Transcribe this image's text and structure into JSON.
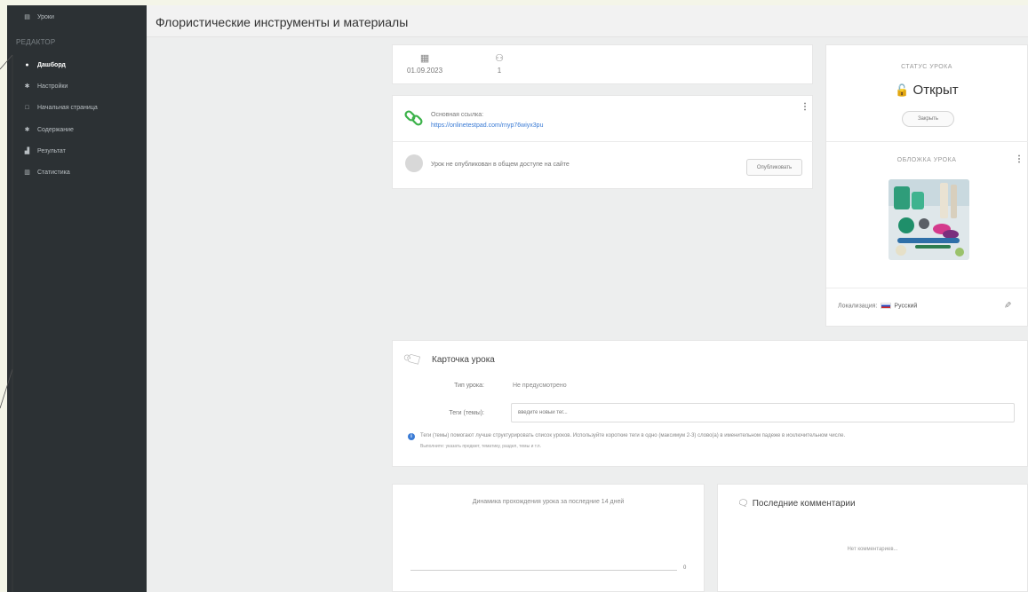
{
  "sidebar": {
    "top_item": {
      "label": "Уроки",
      "icon": "lessons-icon"
    },
    "section": "РЕДАКТОР",
    "items": [
      {
        "label": "Дашборд",
        "icon": "dashboard-icon",
        "active": true
      },
      {
        "label": "Настройки",
        "icon": "gear-icon",
        "active": false
      },
      {
        "label": "Начальная страница",
        "icon": "page-icon",
        "active": false
      },
      {
        "label": "Содержание",
        "icon": "gear-icon",
        "active": false
      },
      {
        "label": "Результат",
        "icon": "results-icon",
        "active": false
      },
      {
        "label": "Статистика",
        "icon": "stats-icon",
        "active": false
      }
    ]
  },
  "header": {
    "title": "Флористические инструменты и материалы"
  },
  "stats": {
    "date": "01.09.2023",
    "participants": "1"
  },
  "link_card": {
    "label": "Основная ссылка:",
    "url": "https://onlinetestpad.com/rnyp76wiyx3pu",
    "unpublished_text": "Урок не опубликован в общем доступе на сайте",
    "publish_button": "Опубликовать"
  },
  "status_card": {
    "heading": "СТАТУС УРОКА",
    "value": "Открыт",
    "close_button": "Закрыть",
    "cover_heading": "ОБЛОЖКА УРОКА",
    "localization_label": "Локализация:",
    "localization_value": "Русский"
  },
  "lesson_card": {
    "title": "Карточка урока",
    "type_label": "Тип урока:",
    "type_value": "Не предусмотрено",
    "tags_label": "Теги (темы):",
    "tags_placeholder": "введите новый тег...",
    "hint_line1": "Теги (темы) помогают лучше структурировать список уроков. Используйте короткие теги в одно (максимум 2-3) слово(а) в именительном падеже в исключительном числе.",
    "hint_line2": "Выполните: указать предмет, тематику, раздел, темы и т.п."
  },
  "chart_card": {
    "title": "Динамика прохождения урока за последние 14 дней"
  },
  "chart_data": {
    "type": "line",
    "title": "Динамика прохождения урока за последние 14 дней",
    "x": [],
    "values": [],
    "y_tick_labels": [
      "0"
    ]
  },
  "comments_card": {
    "title": "Последние комментарии",
    "empty_text": "Нет комментариев..."
  },
  "colors": {
    "sidebar_bg": "#2c3134",
    "accent_green": "#2aa24a",
    "link_blue": "#3a7bd5"
  }
}
